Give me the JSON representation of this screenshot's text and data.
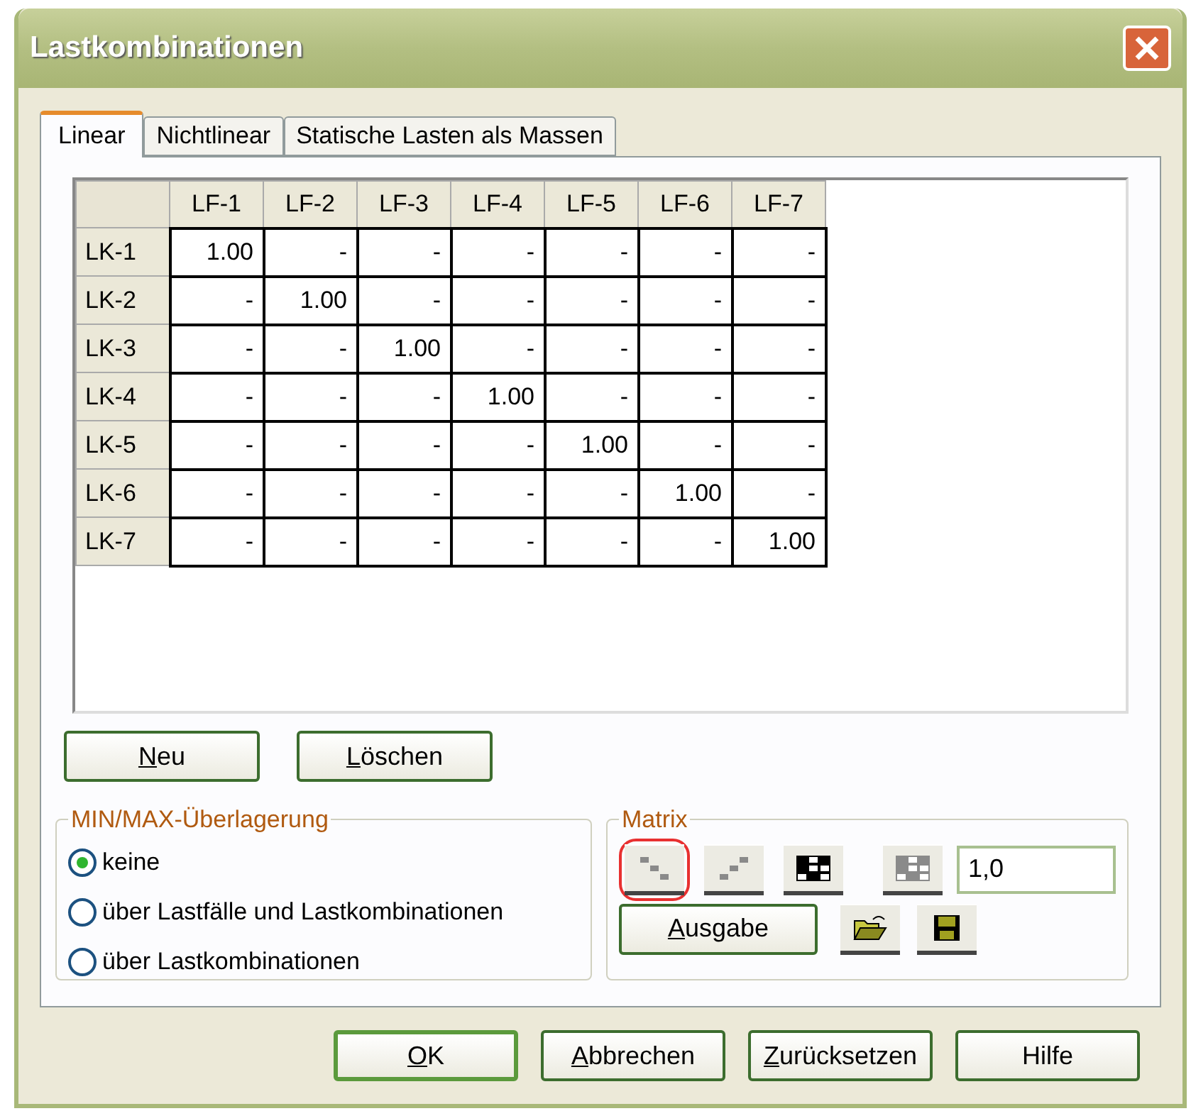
{
  "window": {
    "title": "Lastkombinationen"
  },
  "tabs": [
    {
      "label": "Linear",
      "selected": true
    },
    {
      "label": "Nichtlinear",
      "selected": false
    },
    {
      "label": "Statische Lasten als Massen",
      "selected": false
    }
  ],
  "table": {
    "columns": [
      "LF-1",
      "LF-2",
      "LF-3",
      "LF-4",
      "LF-5",
      "LF-6",
      "LF-7"
    ],
    "rows": [
      {
        "label": "LK-1",
        "cells": [
          "1.00",
          "-",
          "-",
          "-",
          "-",
          "-",
          "-"
        ]
      },
      {
        "label": "LK-2",
        "cells": [
          "-",
          "1.00",
          "-",
          "-",
          "-",
          "-",
          "-"
        ]
      },
      {
        "label": "LK-3",
        "cells": [
          "-",
          "-",
          "1.00",
          "-",
          "-",
          "-",
          "-"
        ]
      },
      {
        "label": "LK-4",
        "cells": [
          "-",
          "-",
          "-",
          "1.00",
          "-",
          "-",
          "-"
        ]
      },
      {
        "label": "LK-5",
        "cells": [
          "-",
          "-",
          "-",
          "-",
          "1.00",
          "-",
          "-"
        ]
      },
      {
        "label": "LK-6",
        "cells": [
          "-",
          "-",
          "-",
          "-",
          "-",
          "1.00",
          "-"
        ]
      },
      {
        "label": "LK-7",
        "cells": [
          "-",
          "-",
          "-",
          "-",
          "-",
          "-",
          "1.00"
        ]
      }
    ]
  },
  "row_buttons": [
    {
      "label": "Neu",
      "underline_first": true
    },
    {
      "label": "Löschen",
      "underline_first": true
    }
  ],
  "minmax": {
    "title": "MIN/MAX-Überlagerung",
    "options": [
      {
        "label": "keine",
        "selected": true
      },
      {
        "label": "über Lastfälle und Lastkombinationen",
        "selected": false
      },
      {
        "label": "über Lastkombinationen",
        "selected": false
      }
    ]
  },
  "matrix": {
    "title": "Matrix",
    "tools": [
      {
        "kind": "diagonal",
        "highlighted": true
      },
      {
        "kind": "antidiagonal",
        "highlighted": false
      },
      {
        "kind": "full",
        "highlighted": false
      },
      {
        "kind": "fill",
        "highlighted": false
      }
    ],
    "factor": "1,0",
    "output_button": {
      "label": "Ausgabe",
      "underline_first": true
    },
    "file_tools": [
      {
        "kind": "open"
      },
      {
        "kind": "save"
      }
    ]
  },
  "buttons": [
    {
      "label": "OK",
      "underline_first": true,
      "default": true
    },
    {
      "label": "Abbrechen",
      "underline_first": true,
      "default": false
    },
    {
      "label": "Zurücksetzen",
      "underline_first": true,
      "default": false
    },
    {
      "label": "Hilfe",
      "underline_first": false,
      "default": false
    }
  ]
}
